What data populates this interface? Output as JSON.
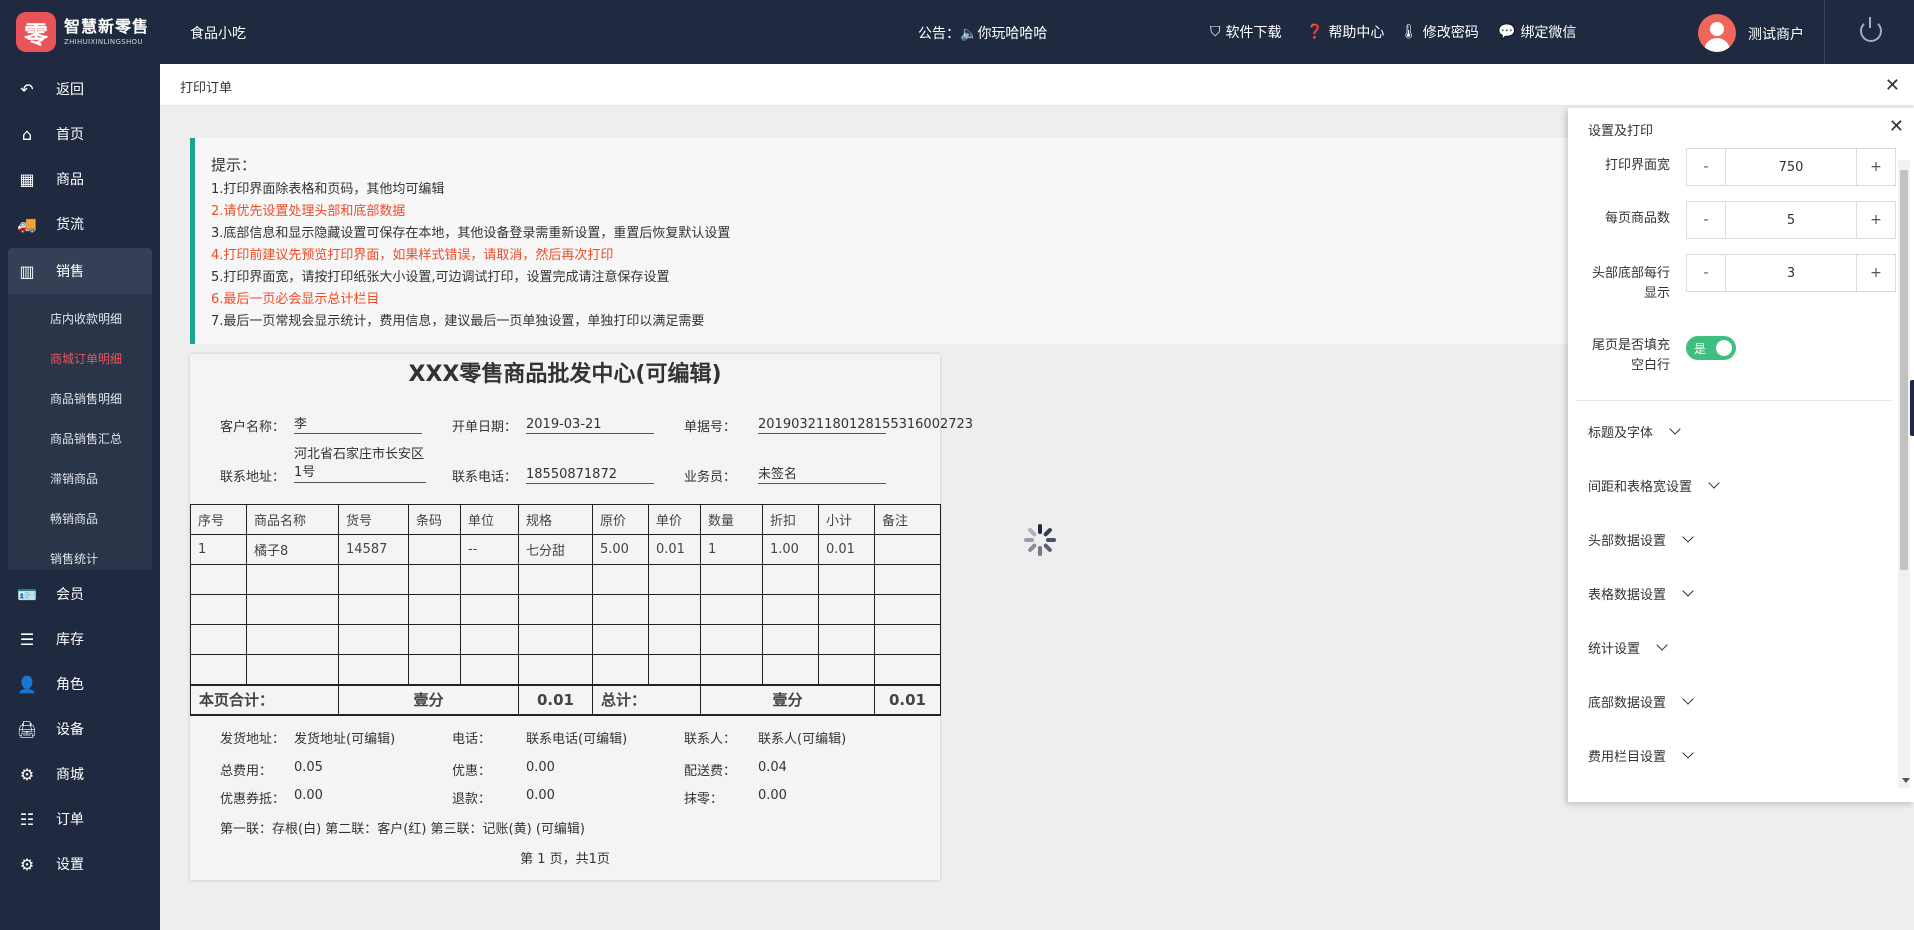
{
  "header": {
    "logo_mark": "零",
    "logo_cn": "智慧新零售",
    "logo_en": "ZHIHUIXINLINGSHOU",
    "store": "食品小吃",
    "notice_label": "公告：",
    "notice_text": "你玩哈哈哈",
    "links": [
      {
        "icon": "download-icon",
        "label": "软件下载"
      },
      {
        "icon": "help-icon",
        "label": "帮助中心"
      },
      {
        "icon": "password-icon",
        "label": "修改密码"
      },
      {
        "icon": "wechat-icon",
        "label": "绑定微信"
      }
    ],
    "user": "测试商户"
  },
  "sidebar": {
    "items": [
      {
        "icon": "back-icon",
        "label": "返回"
      },
      {
        "icon": "home-icon",
        "label": "首页"
      },
      {
        "icon": "goods-icon",
        "label": "商品"
      },
      {
        "icon": "truck-icon",
        "label": "货流"
      },
      {
        "icon": "chart-icon",
        "label": "销售"
      },
      {
        "icon": "member-icon",
        "label": "会员"
      },
      {
        "icon": "database-icon",
        "label": "库存"
      },
      {
        "icon": "user-icon",
        "label": "角色"
      },
      {
        "icon": "printer-icon",
        "label": "设备"
      },
      {
        "icon": "gear-icon",
        "label": "商城"
      },
      {
        "icon": "list-icon",
        "label": "订单"
      },
      {
        "icon": "settings-icon",
        "label": "设置"
      }
    ],
    "sub_items": [
      "店内收款明细",
      "商城订单明细",
      "商品销售明细",
      "商品销售汇总",
      "滞销商品",
      "畅销商品",
      "销售统计"
    ],
    "accent": "#e9545a"
  },
  "tab": {
    "title": "打印订单"
  },
  "tips": {
    "title": "提示：",
    "lines": [
      "1.打印界面除表格和页码，其他均可编辑",
      "2.请优先设置处理头部和底部数据",
      "3.底部信息和显示隐藏设置可保存在本地，其他设备登录需重新设置，重置后恢复默认设置",
      "4.打印前建议先预览打印界面，如果样式错误，请取消，然后再次打印",
      "5.打印界面宽，请按打印纸张大小设置,可边调试打印，设置完成请注意保存设置",
      "6.最后一页必会显示总计栏目",
      "7.最后一页常规会显示统计，费用信息，建议最后一页单独设置，单独打印以满足需要"
    ],
    "highlight_color": "#f04b27"
  },
  "order": {
    "title": "XXX零售商品批发中心(可编辑)",
    "customer_label": "客户名称：",
    "customer": "李",
    "date_label": "开单日期：",
    "date": "2019-03-21",
    "no_label": "单据号：",
    "no": "20190321180128155316002723",
    "address_label": "联系地址：",
    "address": "河北省石家庄市长安区1号",
    "phone_label": "联系电话：",
    "phone": "18550871872",
    "sales_label": "业务员：",
    "sales": "未签名",
    "columns": [
      "序号",
      "商品名称",
      "货号",
      "条码",
      "单位",
      "规格",
      "原价",
      "单价",
      "数量",
      "折扣",
      "小计",
      "备注"
    ],
    "rows": [
      [
        "1",
        "橘子8",
        "14587",
        "",
        "--",
        "七分甜",
        "5.00",
        "0.01",
        "1",
        "1.00",
        "0.01",
        ""
      ]
    ],
    "page_total_label": "本页合计：",
    "page_total_cn": "壹分",
    "page_total": "0.01",
    "grand_total_label": "总计：",
    "grand_total_cn": "壹分",
    "grand_total": "0.01",
    "footer": {
      "ship_addr_label": "发货地址：",
      "ship_addr": "发货地址(可编辑)",
      "tel_label": "电话：",
      "tel": "联系电话(可编辑)",
      "contact_label": "联系人：",
      "contact": "联系人(可编辑)",
      "fee_label": "总费用：",
      "fee": "0.05",
      "discount_label": "优惠：",
      "discount": "0.00",
      "delivery_label": "配送费：",
      "delivery": "0.04",
      "coupon_label": "优惠券抵：",
      "coupon": "0.00",
      "refund_label": "退款：",
      "refund": "0.00",
      "round_label": "抹零：",
      "round": "0.00",
      "copies": "第一联：存根(白) 第二联：客户(红) 第三联：记账(黄) (可编辑)",
      "page": "第 1 页，共1页"
    }
  },
  "settings": {
    "title": "设置及打印",
    "width_label": "打印界面宽",
    "width": "750",
    "per_page_label": "每页商品数",
    "per_page": "5",
    "header_rows_label": "头部底部每行显示",
    "header_rows": "3",
    "minus": "-",
    "plus": "+",
    "fill_label": "尾页是否填充空白行",
    "fill_value": "是",
    "sections": [
      "标题及字体",
      "间距和表格宽设置",
      "头部数据设置",
      "表格数据设置",
      "统计设置",
      "底部数据设置",
      "费用栏目设置"
    ],
    "toggle_color": "#3fbf7f"
  }
}
